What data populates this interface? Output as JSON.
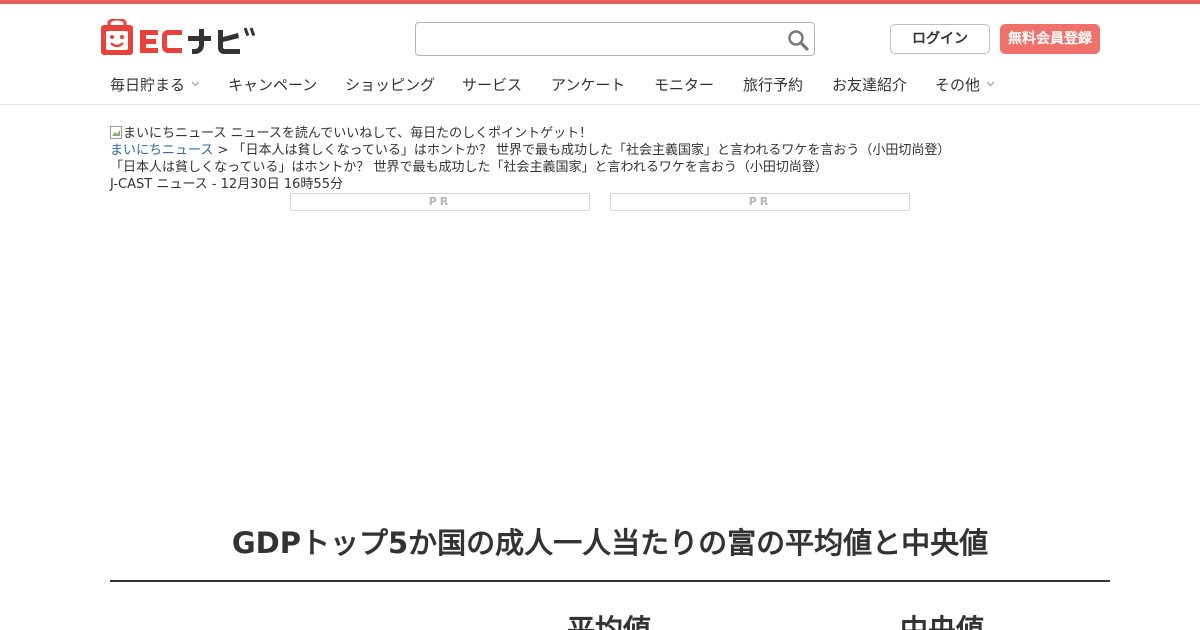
{
  "header": {
    "logo_text": "ECナビ",
    "search": {
      "value": "",
      "placeholder": ""
    },
    "login_label": "ログイン",
    "register_label": "無料会員登録",
    "accent_color": "#e8605e"
  },
  "nav": {
    "items": [
      {
        "label": "毎日貯まる",
        "has_dropdown": true
      },
      {
        "label": "キャンペーン"
      },
      {
        "label": "ショッピング"
      },
      {
        "label": "サービス"
      },
      {
        "label": "アンケート"
      },
      {
        "label": "モニター"
      },
      {
        "label": "旅行予約"
      },
      {
        "label": "お友達紹介"
      },
      {
        "label": "その他",
        "has_dropdown": true
      }
    ]
  },
  "news": {
    "banner_alt": "まいにちニュース",
    "banner_text": "ニュースを読んでいいねして、毎日たのしくポイントゲット！",
    "breadcrumb_home": "まいにちニュース",
    "breadcrumb_separator": ">",
    "breadcrumb_current": "「日本人は貧しくなっている」はホントか？ 世界で最も成功した「社会主義国家」と言われるワケを言おう（小田切尚登）",
    "title": "「日本人は貧しくなっている」はホントか？ 世界で最も成功した「社会主義国家」と言われるワケを言おう（小田切尚登）",
    "source_date": "J-CAST ニュース - 12月30日 16時55分"
  },
  "ads": {
    "left_label": "PR",
    "right_label": "PR"
  },
  "article": {
    "headline": "GDPトップ5か国の成人一人当たりの富の平均値と中央値",
    "col_mean": "平均値",
    "col_median": "中央値"
  }
}
